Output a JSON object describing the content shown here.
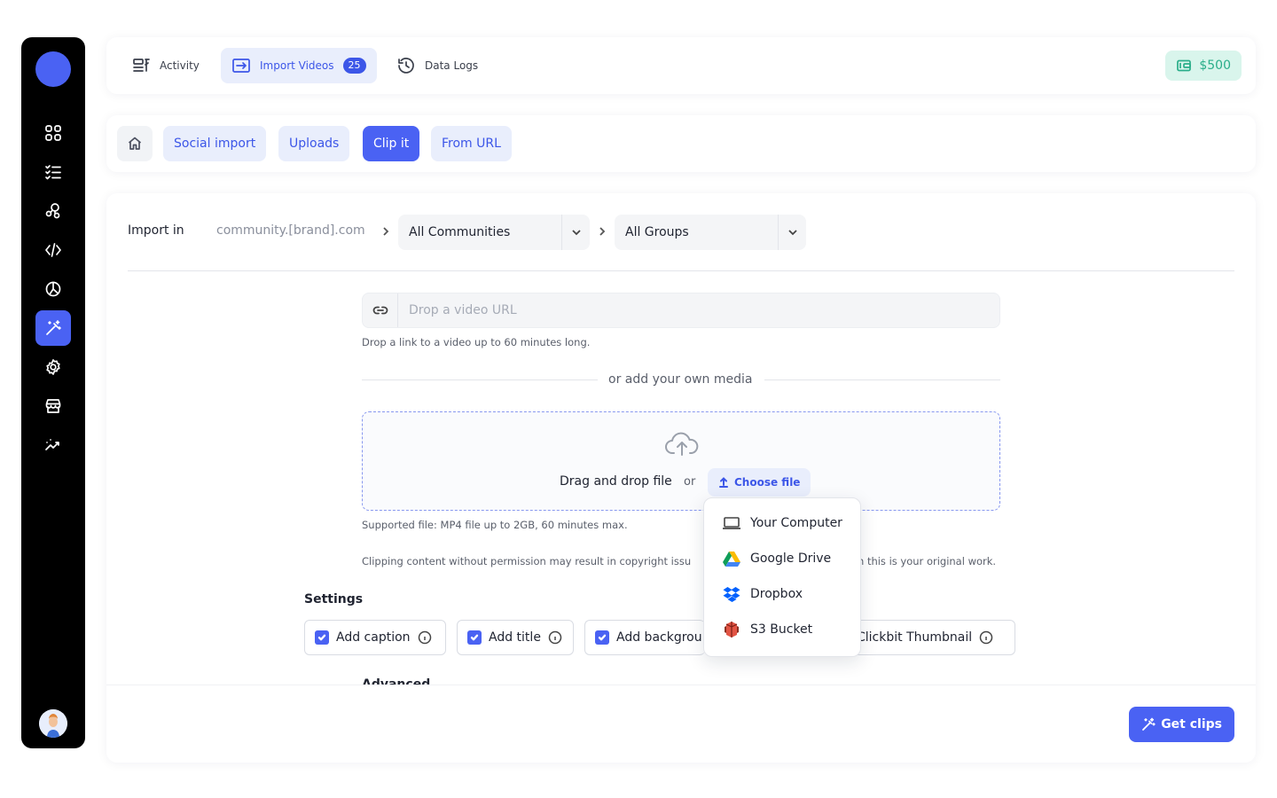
{
  "sidebar": {
    "icons": [
      "grid-icon",
      "checklist-icon",
      "network-icon",
      "code-icon",
      "chart-pie-icon",
      "magic-wand-icon",
      "gear-icon",
      "store-icon",
      "analytics-icon"
    ],
    "active": "magic-wand-icon"
  },
  "topbar": {
    "tabs": [
      {
        "label": "Activity",
        "icon": "activity-icon"
      },
      {
        "label": "Import Videos",
        "icon": "import-icon",
        "badge": "25"
      },
      {
        "label": "Data Logs",
        "icon": "history-icon"
      }
    ],
    "active_tab": "Import Videos",
    "wallet": "$500"
  },
  "subtabs": {
    "items": [
      "Social import",
      "Uploads",
      "Clip it",
      "From URL"
    ],
    "active": "Clip it"
  },
  "import": {
    "label": "Import in",
    "domain": "community.[brand].com",
    "community_select": "All Communities",
    "group_select": "All Groups"
  },
  "url": {
    "placeholder": "Drop a video URL",
    "hint": "Drop a link to a video up to 60 minutes long."
  },
  "media": {
    "or_text": "or add your own media",
    "drag_text": "Drag and drop file",
    "or": "or",
    "choose_file": "Choose file",
    "supported": "Supported file: MP4 file up to 2GB, 60 minutes max.",
    "copyright_left": "Clipping content without permission may result in copyright issu",
    "copyright_right": "n this is your original work."
  },
  "dropdown": {
    "items": [
      "Your Computer",
      "Google Drive",
      "Dropbox",
      "S3 Bucket"
    ]
  },
  "settings": {
    "title": "Settings",
    "options": [
      {
        "label": "Add caption",
        "checked": true
      },
      {
        "label": "Add title",
        "checked": true
      },
      {
        "label": "Add backgrou",
        "checked": true
      },
      {
        "label": "Clickbit Thumbnail",
        "checked": true
      }
    ],
    "advanced": "Advanced"
  },
  "footer": {
    "get_clips": "Get clips"
  },
  "colors": {
    "accent": "#4a62f3",
    "accent_light": "#e9eefc",
    "wallet_bg": "#d9f5ec",
    "wallet_fg": "#2aae8a",
    "sidebar_bg": "#000000"
  }
}
